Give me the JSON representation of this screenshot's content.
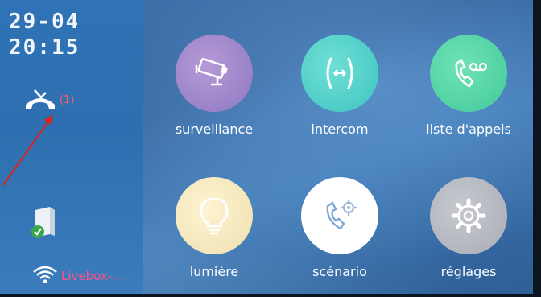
{
  "status": {
    "date": "29-04",
    "time": "20:15",
    "missed_calls": "(1)",
    "wifi_name": "Livebox-..."
  },
  "menu": [
    {
      "label": "surveillance",
      "icon": "camera-icon"
    },
    {
      "label": "intercom",
      "icon": "intercom-icon"
    },
    {
      "label": "liste d'appels",
      "icon": "voicemail-icon"
    },
    {
      "label": "lumière",
      "icon": "bulb-icon"
    },
    {
      "label": "scénario",
      "icon": "phone-gear-icon"
    },
    {
      "label": "réglages",
      "icon": "gear-icon"
    }
  ],
  "colors": {
    "missed": "#ff5a66",
    "wifi_label": "#ff4f8b",
    "annotation_arrow": "#e0201a"
  }
}
